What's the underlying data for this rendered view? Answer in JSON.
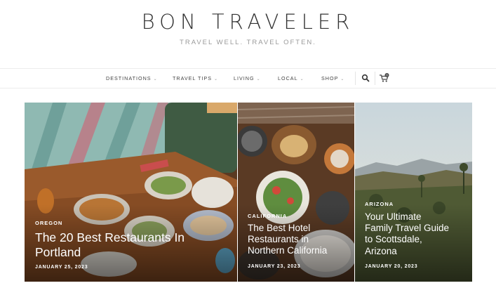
{
  "site": {
    "title": "BON TRAVELER",
    "tagline": "TRAVEL WELL. TRAVEL OFTEN."
  },
  "nav": {
    "items": [
      {
        "label": "DESTINATIONS"
      },
      {
        "label": "TRAVEL TIPS"
      },
      {
        "label": "LIVING"
      },
      {
        "label": "LOCAL"
      },
      {
        "label": "SHOP"
      }
    ],
    "chevron": "⌄",
    "search_icon": "search-icon",
    "cart_icon": "cart-icon",
    "cart_count": "0"
  },
  "posts": [
    {
      "category": "OREGON",
      "title_lines": [
        "The 20 Best Restaurants In",
        "Portland"
      ],
      "date": "JANUARY 25, 2023"
    },
    {
      "category": "CALIFORNIA",
      "title_lines": [
        "The Best Hotel",
        "Restaurants in",
        "Northern California"
      ],
      "date": "JANUARY 23, 2023"
    },
    {
      "category": "ARIZONA",
      "title_lines": [
        "Your Ultimate",
        "Family Travel Guide",
        "to Scottsdale,",
        "Arizona"
      ],
      "date": "JANUARY 20, 2023"
    }
  ],
  "colors": {
    "text_dark": "#333333",
    "tagline": "#9a9a9a",
    "overlay_text": "#ffffff"
  }
}
